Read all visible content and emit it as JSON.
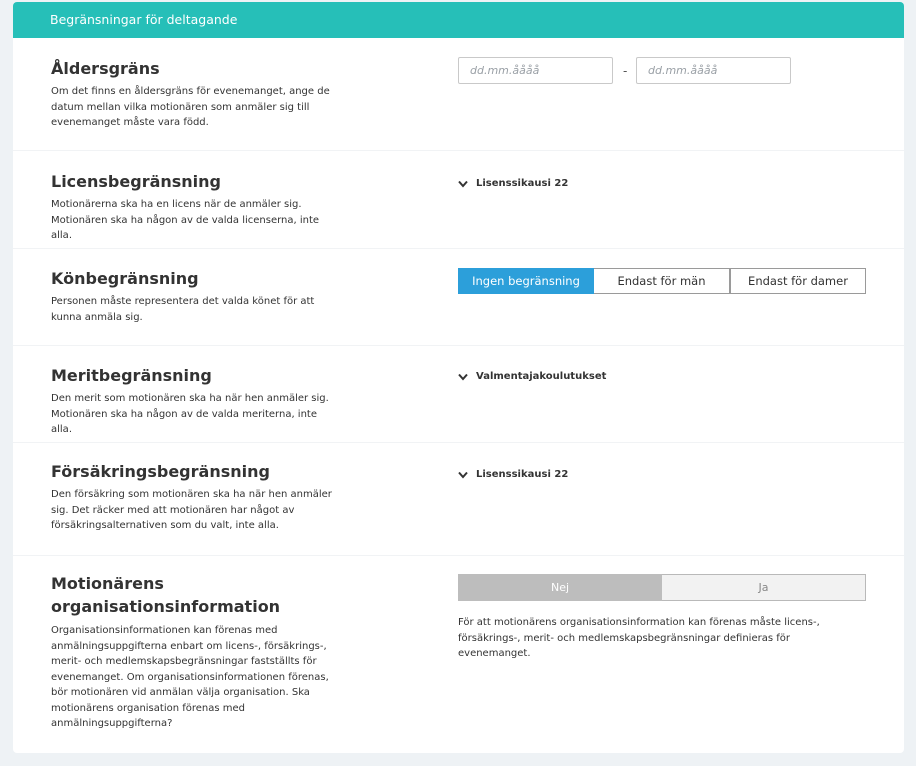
{
  "header": {
    "title": "Begränsningar för deltagande"
  },
  "age": {
    "title": "Åldersgräns",
    "description": "Om det finns en åldersgräns för evenemanget, ange de datum mellan vilka motionären som anmäler sig till evenemanget måste vara född.",
    "from_placeholder": "dd.mm.åååå",
    "to_placeholder": "dd.mm.åååå",
    "separator": "-"
  },
  "license": {
    "title": "Licensbegränsning",
    "description": "Motionärerna ska ha en licens när de anmäler sig. Motionären ska ha någon av de valda licenserna, inte alla.",
    "dropdown_label": "Lisenssikausi 22"
  },
  "gender": {
    "title": "Könbegränsning",
    "description": "Personen måste representera det valda könet för att kunna anmäla sig.",
    "options": [
      "Ingen begränsning",
      "Endast för män",
      "Endast för damer"
    ],
    "selected": "Ingen begränsning"
  },
  "merit": {
    "title": "Meritbegränsning",
    "description": "Den merit som motionären ska ha när hen anmäler sig. Motionären ska ha någon av de valda meriterna, inte alla.",
    "dropdown_label": "Valmentajakoulutukset"
  },
  "insurance": {
    "title": "Försäkringsbegränsning",
    "description": "Den försäkring som motionären ska ha när hen anmäler sig. Det räcker med att motionären har något av försäkringsalternativen som du valt, inte alla.",
    "dropdown_label": "Lisenssikausi 22"
  },
  "org_info": {
    "title_line1": "Motionärens",
    "title_line2": "organisationsinformation",
    "description": "Organisationsinformationen kan förenas med anmälningsuppgifterna enbart om licens-, försäkrings-, merit- och medlemskapsbegränsningar fastställts för evenemanget. Om organisationsinformationen förenas, bör motionären vid anmälan välja organisation. Ska motionärens organisation förenas med anmälningsuppgifterna?",
    "toggle_no": "Nej",
    "toggle_yes": "Ja",
    "selected": "Nej",
    "note": "För att motionärens organisationsinformation kan förenas måste licens-, försäkrings-, merit- och medlemskapsbegränsningar definieras för evenemanget."
  },
  "colors": {
    "header_bg": "#26bfb8",
    "primary_selected": "#2c9fda",
    "toggle_selected": "#bdbdbd"
  }
}
